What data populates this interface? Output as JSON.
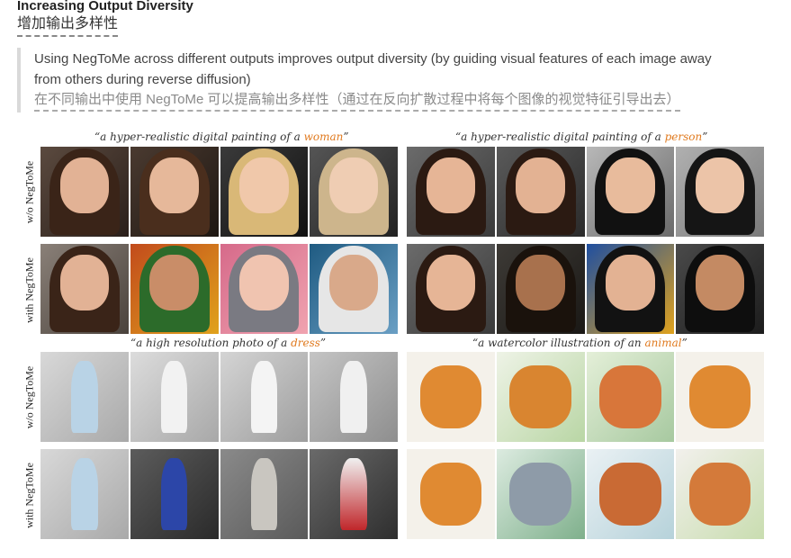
{
  "header": {
    "title": "Increasing Output Diversity",
    "title_zh": "增加输出多样性"
  },
  "quote": {
    "en": "Using NegToMe across different outputs improves output diversity (by guiding visual features of each image away from others during reverse diffusion)",
    "zh": "在不同输出中使用 NegToMe 可以提高输出多样性（通过在反向扩散过程中将每个图像的视觉特征引导出去）"
  },
  "figure": {
    "captions": [
      {
        "prefix": "“a hyper-realistic digital painting of a ",
        "highlight": "woman",
        "suffix": "”"
      },
      {
        "prefix": "“a hyper-realistic digital painting of a ",
        "highlight": "person",
        "suffix": "”"
      },
      {
        "prefix": "“a high resolution photo of a ",
        "highlight": "dress",
        "suffix": "”"
      },
      {
        "prefix": "“a watercolor illustration of an ",
        "highlight": "animal",
        "suffix": "”"
      }
    ],
    "row_labels": [
      "w/o NegToMe",
      "with NegToMe",
      "w/o NegToMe",
      "with NegToMe"
    ],
    "highlight_color": "#e07a1f"
  }
}
